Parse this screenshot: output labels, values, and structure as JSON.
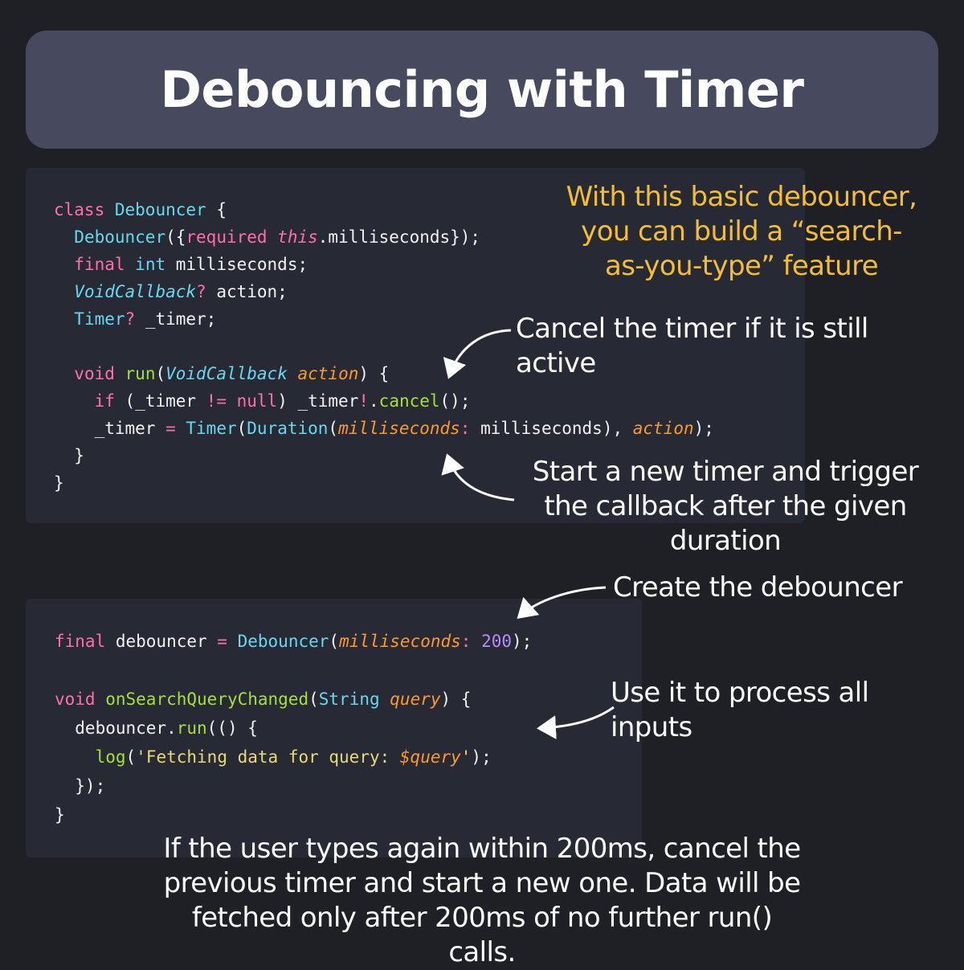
{
  "title": "Debouncing with Timer",
  "code_block_1": {
    "lines": [
      "class Debouncer {",
      "  Debouncer({required this.milliseconds});",
      "  final int milliseconds;",
      "  VoidCallback? action;",
      "  Timer? _timer;",
      "",
      "  void run(VoidCallback action) {",
      "    if (_timer != null) _timer!.cancel();",
      "    _timer = Timer(Duration(milliseconds: milliseconds), action);",
      "  }",
      "}"
    ]
  },
  "code_block_2": {
    "lines": [
      "final debouncer = Debouncer(milliseconds: 200);",
      "",
      "void onSearchQueryChanged(String query) {",
      "  debouncer.run(() {",
      "    log('Fetching data for query: $query');",
      "  });",
      "}"
    ]
  },
  "annotations": {
    "intro": "With this basic debouncer, you can build a “search-as-you-type” feature",
    "cancel_timer": "Cancel the timer if it is still active",
    "start_timer": "Start a new timer and trigger the callback after the given duration",
    "create_debouncer": "Create the debouncer",
    "process_inputs": "Use it to process all inputs",
    "footer": "If the user types again within 200ms, cancel the previous timer and start a new one. Data will be fetched only after 200ms of no further run() calls."
  },
  "colors": {
    "background": "#1f1f26",
    "title_bar": "#474a5e",
    "code_panel": "#272935",
    "keyword": "#ff6fae",
    "type": "#66d9ef",
    "param": "#fd9a2a",
    "function": "#a6e22e",
    "string": "#e6db74",
    "number": "#b58cff",
    "annotation_highlight": "#f5bf2a"
  },
  "icons": [
    "curved-arrow-icon"
  ]
}
